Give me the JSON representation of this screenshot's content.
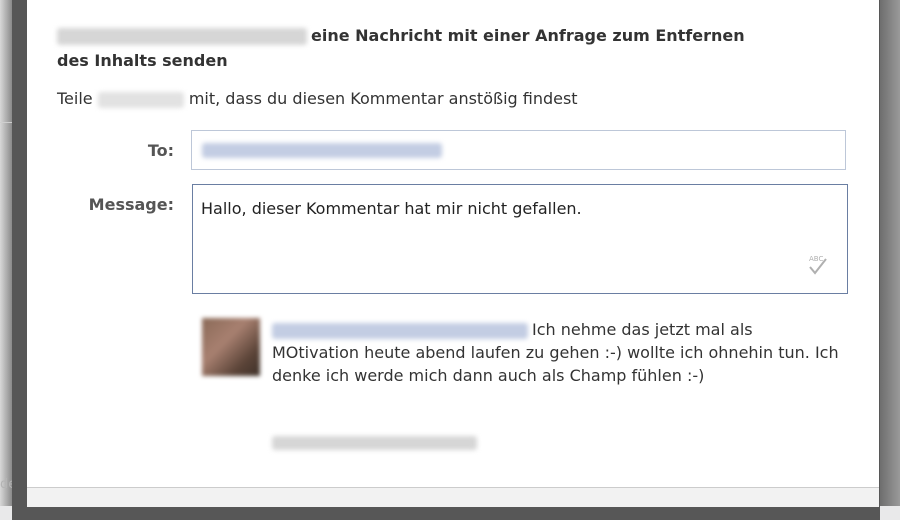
{
  "dialog": {
    "heading_suffix": "eine Nachricht mit einer Anfrage zum Entfernen",
    "heading_line2": "des Inhalts senden",
    "subtext_prefix": "Teile",
    "subtext_suffix": "mit, dass du diesen Kommentar anstößig findest"
  },
  "form": {
    "to_label": "To:",
    "message_label": "Message:",
    "message_value": "Hallo, dieser Kommentar hat mir nicht gefallen."
  },
  "comment": {
    "text": "Ich nehme das jetzt mal als MOtivation heute abend laufen zu gehen :-) wollte ich ohnehin tun. Ich denke ich werde mich dann auch als Champ fühlen :-)"
  },
  "icons": {
    "spellcheck": "spellcheck-abc-icon"
  },
  "colors": {
    "input_border": "#bdc7d8",
    "textarea_border": "#6a7ea2",
    "redacted_blue": "#c3cde3",
    "redacted_gray": "#d6d6d6",
    "overlay": "#575757"
  }
}
